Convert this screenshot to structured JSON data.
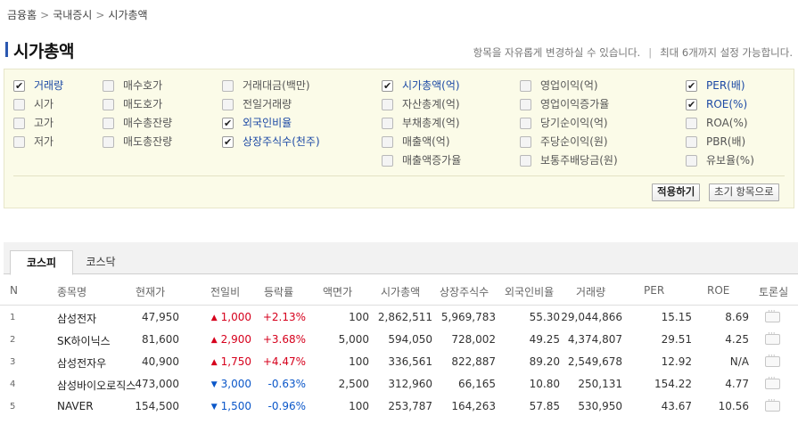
{
  "breadcrumb": [
    "금융홈",
    "국내증시",
    "시가총액"
  ],
  "page_title": "시가총액",
  "note": {
    "left": "항목을 자유롭게 변경하실 수 있습니다.",
    "right": "최대 6개까지 설정 가능합니다."
  },
  "option_columns": [
    [
      {
        "label": "거래량",
        "checked": true
      },
      {
        "label": "시가",
        "checked": false
      },
      {
        "label": "고가",
        "checked": false
      },
      {
        "label": "저가",
        "checked": false
      }
    ],
    [
      {
        "label": "매수호가",
        "checked": false
      },
      {
        "label": "매도호가",
        "checked": false
      },
      {
        "label": "매수총잔량",
        "checked": false
      },
      {
        "label": "매도총잔량",
        "checked": false
      }
    ],
    [
      {
        "label": "거래대금(백만)",
        "checked": false
      },
      {
        "label": "전일거래량",
        "checked": false
      },
      {
        "label": "외국인비율",
        "checked": true
      },
      {
        "label": "상장주식수(천주)",
        "checked": true
      }
    ],
    [
      {
        "label": "시가총액(억)",
        "checked": true
      },
      {
        "label": "자산총계(억)",
        "checked": false
      },
      {
        "label": "부채총계(억)",
        "checked": false
      },
      {
        "label": "매출액(억)",
        "checked": false
      },
      {
        "label": "매출액증가율",
        "checked": false
      }
    ],
    [
      {
        "label": "영업이익(억)",
        "checked": false
      },
      {
        "label": "영업이익증가율",
        "checked": false
      },
      {
        "label": "당기순이익(억)",
        "checked": false
      },
      {
        "label": "주당순이익(원)",
        "checked": false
      },
      {
        "label": "보통주배당금(원)",
        "checked": false
      }
    ],
    [
      {
        "label": "PER(배)",
        "checked": true
      },
      {
        "label": "ROE(%)",
        "checked": true
      },
      {
        "label": "ROA(%)",
        "checked": false
      },
      {
        "label": "PBR(배)",
        "checked": false
      },
      {
        "label": "유보율(%)",
        "checked": false
      }
    ]
  ],
  "buttons": {
    "apply": "적용하기",
    "reset": "초기 항목으로"
  },
  "tabs": [
    "코스피",
    "코스닥"
  ],
  "columns": [
    "N",
    "종목명",
    "현재가",
    "전일비",
    "등락률",
    "액면가",
    "시가총액",
    "상장주식수",
    "외국인비율",
    "거래량",
    "PER",
    "ROE",
    "토론실"
  ],
  "rows": [
    {
      "n": "1",
      "name": "삼성전자",
      "price": "47,950",
      "dir": "up",
      "change": "1,000",
      "rate": "+2.13%",
      "par": "100",
      "mcap": "2,862,511",
      "shares": "5,969,783",
      "foreign": "55.30",
      "volume": "29,044,866",
      "per": "15.15",
      "roe": "8.69"
    },
    {
      "n": "2",
      "name": "SK하이닉스",
      "price": "81,600",
      "dir": "up",
      "change": "2,900",
      "rate": "+3.68%",
      "par": "5,000",
      "mcap": "594,050",
      "shares": "728,002",
      "foreign": "49.25",
      "volume": "4,374,807",
      "per": "29.51",
      "roe": "4.25"
    },
    {
      "n": "3",
      "name": "삼성전자우",
      "price": "40,900",
      "dir": "up",
      "change": "1,750",
      "rate": "+4.47%",
      "par": "100",
      "mcap": "336,561",
      "shares": "822,887",
      "foreign": "89.20",
      "volume": "2,549,678",
      "per": "12.92",
      "roe": "N/A"
    },
    {
      "n": "4",
      "name": "삼성바이오로직스",
      "price": "473,000",
      "dir": "down",
      "change": "3,000",
      "rate": "-0.63%",
      "par": "2,500",
      "mcap": "312,960",
      "shares": "66,165",
      "foreign": "10.80",
      "volume": "250,131",
      "per": "154.22",
      "roe": "4.77"
    },
    {
      "n": "5",
      "name": "NAVER",
      "price": "154,500",
      "dir": "down",
      "change": "1,500",
      "rate": "-0.96%",
      "par": "100",
      "mcap": "253,787",
      "shares": "164,263",
      "foreign": "57.85",
      "volume": "530,950",
      "per": "43.67",
      "roe": "10.56"
    }
  ],
  "colors": {
    "up": "#d6001c",
    "down": "#0b57c9",
    "checked_label": "#1d4aa5",
    "panel_bg": "#fbfbe8"
  },
  "icons": {
    "up": "triangle-up-icon",
    "down": "triangle-down-icon",
    "discussion": "speech-bubble-icon"
  }
}
